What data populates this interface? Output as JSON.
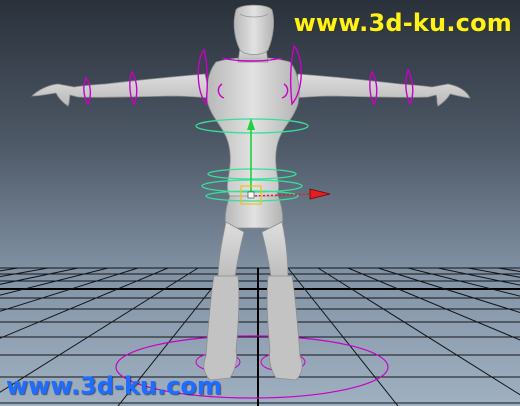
{
  "viewport": {
    "name": "3D viewport (perspective)",
    "background_top": "#2a313b",
    "background_bottom": "#9fb0c1",
    "grid_color": "#101216"
  },
  "scene": {
    "model": "humanoid-t-pose",
    "model_color": "#c9c9c9",
    "control_curve_color": "#c800c8",
    "selected_curve_color": "#35e09a",
    "move_manipulator_axis_colors": {
      "x": "#e02020",
      "y": "#20d040",
      "z": "#2040e0"
    }
  },
  "watermarks": {
    "top": "www.3d-ku.com",
    "top_color": "#fff21a",
    "bottom": "www.3d-ku.com",
    "bottom_color": "#1e6dff"
  }
}
